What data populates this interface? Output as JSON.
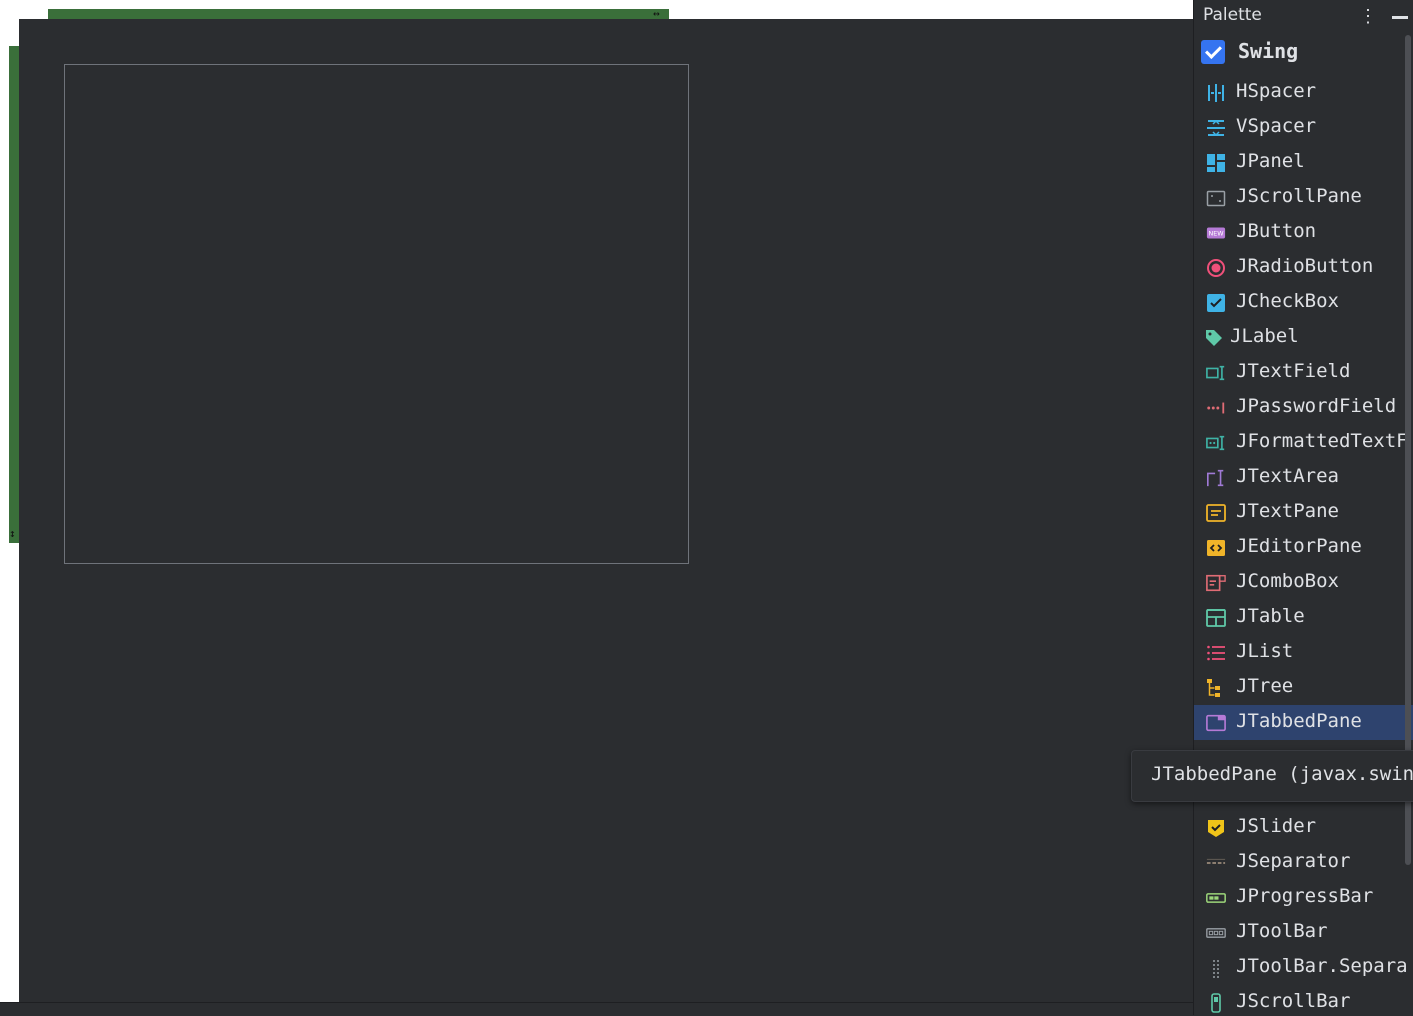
{
  "palette": {
    "title": "Palette",
    "group": {
      "label": "Swing",
      "checked": true
    },
    "items": [
      {
        "label": "HSpacer",
        "icon": "hspacer-icon",
        "color": "#3fb3e6"
      },
      {
        "label": "VSpacer",
        "icon": "vspacer-icon",
        "color": "#3fb3e6"
      },
      {
        "label": "JPanel",
        "icon": "panel-icon",
        "color": "#3fb3e6"
      },
      {
        "label": "JScrollPane",
        "icon": "scrollpane-icon",
        "color": "#9aa0a6"
      },
      {
        "label": "JButton",
        "icon": "button-icon",
        "color": "#b57ad6"
      },
      {
        "label": "JRadioButton",
        "icon": "radio-button-icon",
        "color": "#f0507a"
      },
      {
        "label": "JCheckBox",
        "icon": "checkbox-icon",
        "color": "#3fb3e6"
      },
      {
        "label": "JLabel",
        "icon": "label-tag-icon",
        "color": "#5fc9a8"
      },
      {
        "label": "JTextField",
        "icon": "textfield-icon",
        "color": "#3fb3a6"
      },
      {
        "label": "JPasswordField",
        "icon": "password-field-icon",
        "color": "#e06c75"
      },
      {
        "label": "JFormattedTextF",
        "icon": "formatted-textfield-icon",
        "color": "#3fb3a6"
      },
      {
        "label": "JTextArea",
        "icon": "textarea-icon",
        "color": "#a07ad6"
      },
      {
        "label": "JTextPane",
        "icon": "textpane-icon",
        "color": "#f0b429"
      },
      {
        "label": "JEditorPane",
        "icon": "editorpane-icon",
        "color": "#f0b429"
      },
      {
        "label": "JComboBox",
        "icon": "combobox-icon",
        "color": "#e06c75"
      },
      {
        "label": "JTable",
        "icon": "table-icon",
        "color": "#5fc9a8"
      },
      {
        "label": "JList",
        "icon": "list-icon",
        "color": "#f0507a"
      },
      {
        "label": "JTree",
        "icon": "tree-icon",
        "color": "#f0b429"
      },
      {
        "label": "JTabbedPane",
        "icon": "tabbedpane-icon",
        "color": "#b57ad6"
      },
      {
        "label": "",
        "icon": "hidden-item-icon",
        "color": "#9aa0a6"
      },
      {
        "label": "",
        "icon": "hidden-item-icon",
        "color": "#5fc9a8"
      },
      {
        "label": "JSlider",
        "icon": "slider-icon",
        "color": "#f0c419"
      },
      {
        "label": "JSeparator",
        "icon": "separator-icon",
        "color": "#9a8a7a"
      },
      {
        "label": "JProgressBar",
        "icon": "progressbar-icon",
        "color": "#9cd67a"
      },
      {
        "label": "JToolBar",
        "icon": "toolbar-icon",
        "color": "#9aa0a6"
      },
      {
        "label": "JToolBar.Separa",
        "icon": "toolbar-separator-icon",
        "color": "#9aa0a6"
      },
      {
        "label": "JScrollBar",
        "icon": "scrollbar-icon",
        "color": "#5fc9a8"
      }
    ],
    "selected_index": 18
  },
  "tooltip": {
    "text": "JTabbedPane (javax.swing)"
  },
  "colors": {
    "canvas": "#2b2d30",
    "selection": "#2e436e",
    "accent": "#3574f0",
    "form_border": "#6f737a",
    "green_handle": "#3a6f3a"
  }
}
